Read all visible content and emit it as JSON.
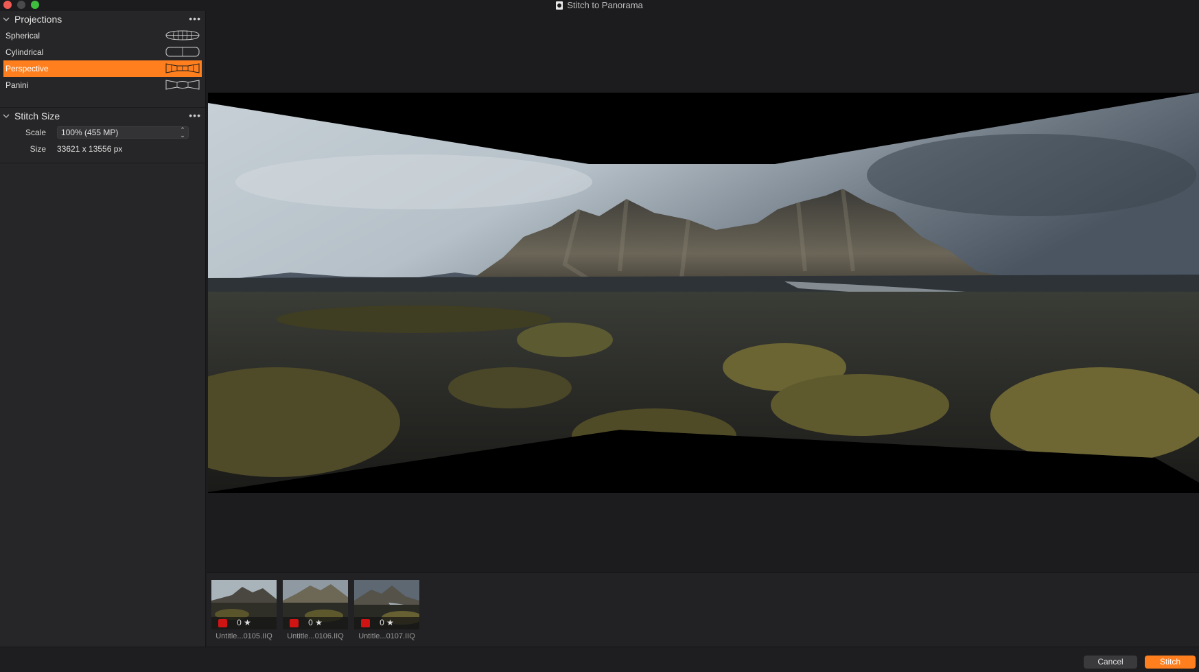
{
  "window": {
    "title": "Stitch to Panorama"
  },
  "projections": {
    "title": "Projections",
    "items": [
      {
        "label": "Spherical",
        "icon": "spherical-projection-icon",
        "selected": false
      },
      {
        "label": "Cylindrical",
        "icon": "cylindrical-projection-icon",
        "selected": false
      },
      {
        "label": "Perspective",
        "icon": "perspective-projection-icon",
        "selected": true
      },
      {
        "label": "Panini",
        "icon": "panini-projection-icon",
        "selected": false
      }
    ]
  },
  "stitch_size": {
    "title": "Stitch Size",
    "scale_label": "Scale",
    "scale_value": "100% (455 MP)",
    "size_label": "Size",
    "size_value": "33621 x 13556 px"
  },
  "filmstrip": {
    "items": [
      {
        "name": "Untitle...0105.IIQ",
        "rating": "0 ★",
        "color_tag": "#d01414"
      },
      {
        "name": "Untitle...0106.IIQ",
        "rating": "0 ★",
        "color_tag": "#d01414"
      },
      {
        "name": "Untitle...0107.IIQ",
        "rating": "0 ★",
        "color_tag": "#d01414"
      }
    ]
  },
  "buttons": {
    "cancel": "Cancel",
    "stitch": "Stitch"
  },
  "colors": {
    "accent": "#ff7f1e",
    "background": "#1c1c1e",
    "sidebar": "#262628"
  }
}
